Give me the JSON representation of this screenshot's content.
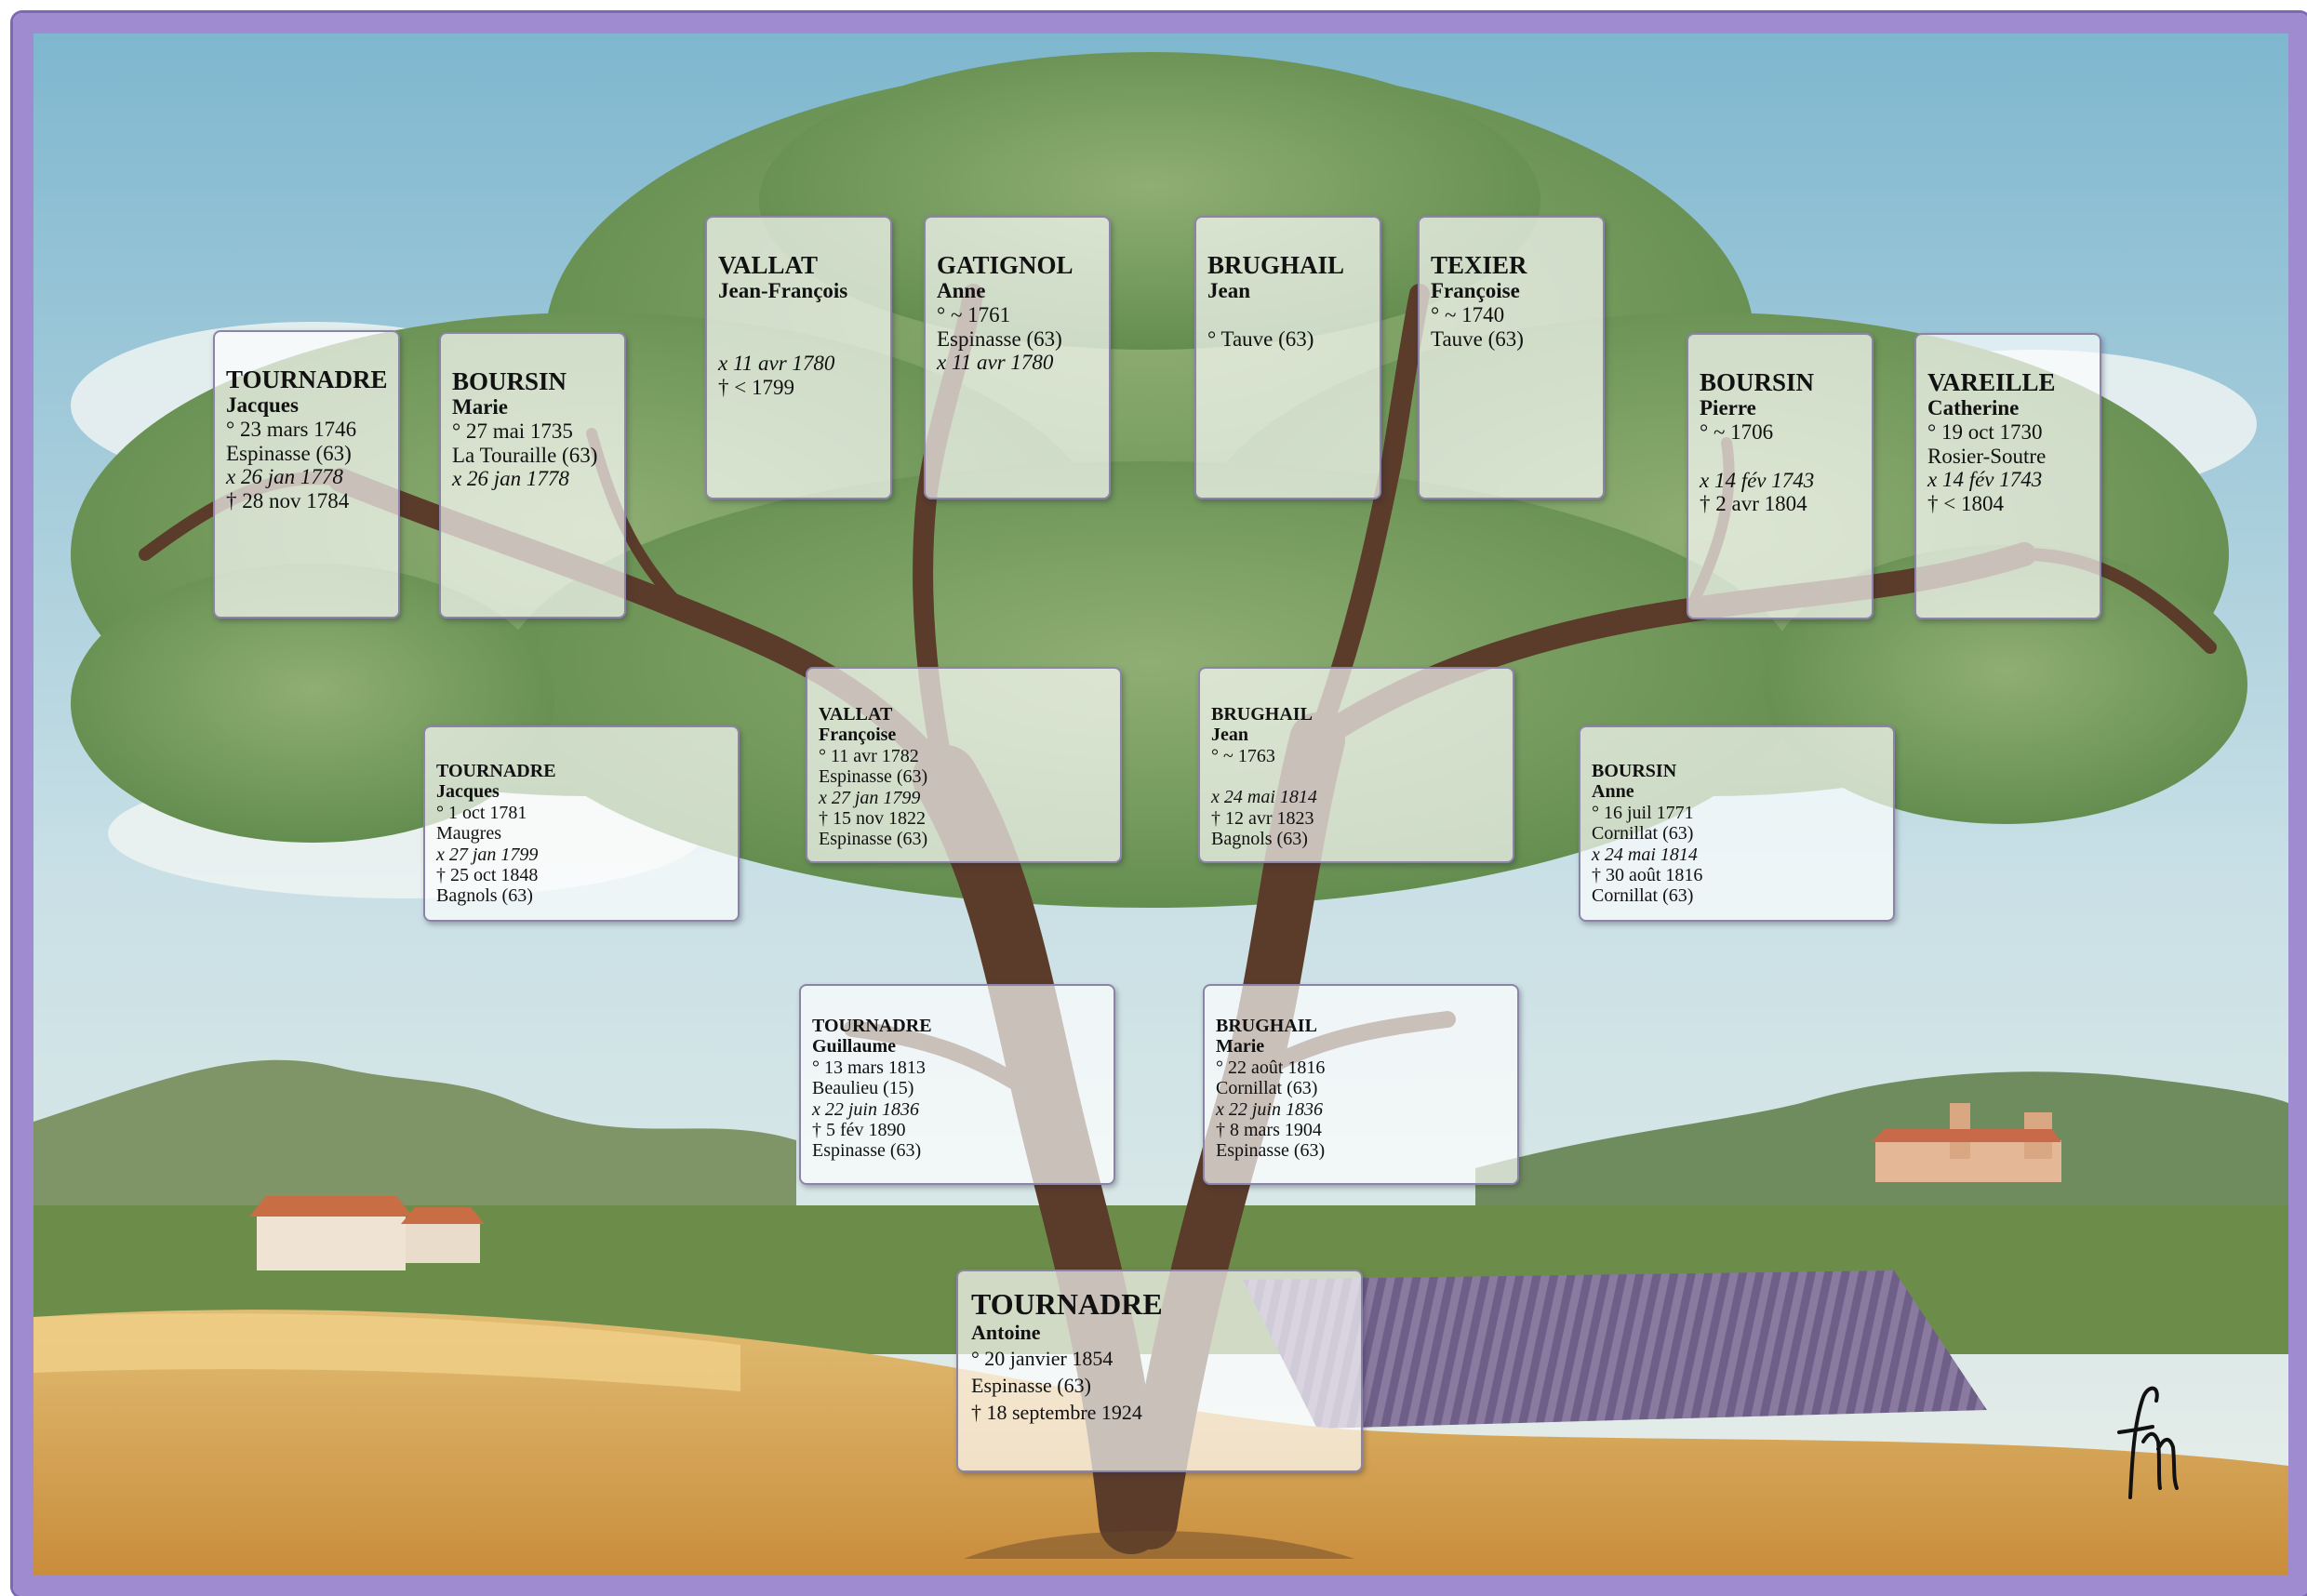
{
  "frame_color": "#9f8bd0",
  "people": {
    "root": {
      "surname": "TOURNADRE",
      "given": "Antoine",
      "lines": [
        "° 20 janvier 1854",
        "Espinasse (63)",
        "† 18 septembre 1924"
      ]
    },
    "father": {
      "surname": "TOURNADRE",
      "given": "Guillaume",
      "lines": [
        "° 13 mars 1813",
        "Beaulieu (15)",
        "x 22 juin 1836",
        "† 5 fév 1890",
        "Espinasse (63)"
      ]
    },
    "mother": {
      "surname": "BRUGHAIL",
      "given": "Marie",
      "lines": [
        "° 22 août 1816",
        "Cornillat (63)",
        "x 22 juin 1836",
        "† 8 mars 1904",
        "Espinasse (63)"
      ]
    },
    "ff": {
      "surname": "TOURNADRE",
      "given": "Jacques",
      "lines": [
        "° 1 oct 1781",
        "Maugres",
        "x 27 jan 1799",
        "† 25 oct 1848",
        "Bagnols (63)"
      ]
    },
    "fm": {
      "surname": "VALLAT",
      "given": "Françoise",
      "lines": [
        "° 11 avr 1782",
        "Espinasse (63)",
        "x 27 jan 1799",
        "† 15 nov 1822",
        "Espinasse (63)"
      ]
    },
    "mf": {
      "surname": "BRUGHAIL",
      "given": "Jean",
      "lines": [
        "° ~ 1763",
        "",
        "x 24 mai 1814",
        "† 12 avr 1823",
        "Bagnols (63)"
      ]
    },
    "mm": {
      "surname": "BOURSIN",
      "given": "Anne",
      "lines": [
        "° 16 juil 1771",
        "Cornillat (63)",
        "x 24 mai 1814",
        "† 30 août 1816",
        "Cornillat (63)"
      ]
    },
    "fff": {
      "surname": "TOURNADRE",
      "given": "Jacques",
      "lines": [
        "° 23 mars 1746",
        "Espinasse (63)",
        "x 26 jan 1778",
        "† 28 nov 1784"
      ]
    },
    "ffm": {
      "surname": "BOURSIN",
      "given": "Marie",
      "lines": [
        "° 27 mai 1735",
        "La Touraille (63)",
        "x 26 jan 1778"
      ]
    },
    "fmf": {
      "surname": "VALLAT",
      "given": "Jean-François",
      "lines": [
        "",
        "",
        "x 11 avr 1780",
        "† < 1799"
      ]
    },
    "fmm": {
      "surname": "GATIGNOL",
      "given": "Anne",
      "lines": [
        "° ~ 1761",
        "Espinasse (63)",
        "x 11 avr 1780"
      ]
    },
    "mff": {
      "surname": "BRUGHAIL",
      "given": "Jean",
      "lines": [
        "",
        "° Tauve (63)"
      ]
    },
    "mfm": {
      "surname": "TEXIER",
      "given": "Françoise",
      "lines": [
        "° ~ 1740",
        "Tauve (63)"
      ]
    },
    "mmf": {
      "surname": "BOURSIN",
      "given": "Pierre",
      "lines": [
        "° ~ 1706",
        "",
        "x 14 fév 1743",
        "† 2 avr 1804"
      ]
    },
    "mmm": {
      "surname": "VAREILLE",
      "given": "Catherine",
      "lines": [
        "° 19 oct 1730",
        "Rosier-Soutre",
        "x 14 fév 1743",
        "† < 1804"
      ]
    }
  }
}
